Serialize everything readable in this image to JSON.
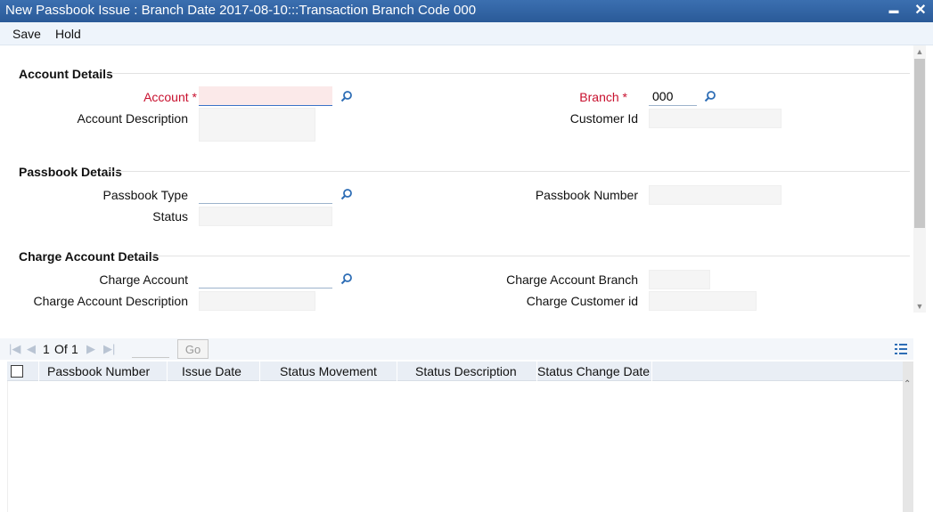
{
  "window": {
    "title": "New Passbook Issue : Branch Date 2017-08-10:::Transaction Branch Code 000",
    "minimize_glyph": "▬",
    "close_glyph": "✕"
  },
  "menu": {
    "save": "Save",
    "hold": "Hold"
  },
  "sections": {
    "account": "Account Details",
    "passbook": "Passbook Details",
    "charge": "Charge Account Details"
  },
  "fields": {
    "account_label": "Account *",
    "account_value": "",
    "account_desc_label": "Account Description",
    "branch_label": "Branch *",
    "branch_value": "000",
    "customer_id_label": "Customer Id",
    "passbook_type_label": "Passbook Type",
    "passbook_number_label": "Passbook Number",
    "status_label": "Status",
    "charge_account_label": "Charge Account",
    "charge_account_branch_label": "Charge Account Branch",
    "charge_account_desc_label": "Charge Account Description",
    "charge_customer_id_label": "Charge Customer id"
  },
  "grid": {
    "page_current": "1",
    "page_of": "Of",
    "page_total": "1",
    "go_label": "Go",
    "columns": [
      "Passbook Number",
      "Issue Date",
      "Status Movement",
      "Status Description",
      "Status Change Date"
    ]
  },
  "colors": {
    "titlebar": "#2f63a4",
    "required_label": "#c8102e",
    "lookup_icon": "#2d6db5"
  },
  "icons": {
    "lookup": "search-icon",
    "grid_menu": "list-icon"
  }
}
